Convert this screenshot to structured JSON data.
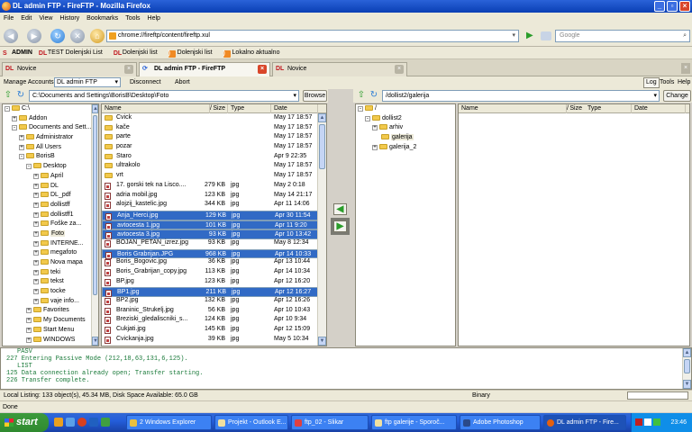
{
  "window": {
    "title": "DL admin FTP - FireFTP - Mozilla Firefox"
  },
  "menubar": [
    "File",
    "Edit",
    "View",
    "History",
    "Bookmarks",
    "Tools",
    "Help"
  ],
  "navbar": {
    "url": "chrome://fireftp/content/fireftp.xul",
    "search_placeholder": "Google"
  },
  "bookmarks": [
    "ADMIN",
    "TEST Dolenjski List",
    "Dolenjski list",
    "Dolenjski list",
    "Lokalno aktualno"
  ],
  "tabs": [
    "Novice",
    "DL admin FTP - FireFTP",
    "Novice"
  ],
  "ftpbar": {
    "manage_accounts": "Manage Accounts",
    "account": "DL admin FTP",
    "disconnect": "Disconnect",
    "abort": "Abort",
    "log": "Log",
    "tools": "Tools",
    "help": "Help"
  },
  "local": {
    "path": "C:\\Documents and Settings\\BorisB\\Desktop\\Foto",
    "browse": "Browse",
    "tree": [
      {
        "label": "C:\\",
        "level": 0,
        "exp": "-"
      },
      {
        "label": "Addon",
        "level": 1,
        "exp": "+"
      },
      {
        "label": "Documents and Sett...",
        "level": 1,
        "exp": "-"
      },
      {
        "label": "Administrator",
        "level": 2,
        "exp": "+"
      },
      {
        "label": "All Users",
        "level": 2,
        "exp": "+"
      },
      {
        "label": "BorisB",
        "level": 2,
        "exp": "-"
      },
      {
        "label": "Desktop",
        "level": 3,
        "exp": "-"
      },
      {
        "label": "April",
        "level": 4,
        "exp": "+"
      },
      {
        "label": "DL",
        "level": 4,
        "exp": "+"
      },
      {
        "label": "DL_pdf",
        "level": 4,
        "exp": "+"
      },
      {
        "label": "dollistff",
        "level": 4,
        "exp": "+"
      },
      {
        "label": "dollistff1",
        "level": 4,
        "exp": "+"
      },
      {
        "label": "Foške za...",
        "level": 4,
        "exp": "+"
      },
      {
        "label": "Foto",
        "level": 4,
        "exp": "+",
        "selected": true
      },
      {
        "label": "INTERNE...",
        "level": 4,
        "exp": "+"
      },
      {
        "label": "megafoto",
        "level": 4,
        "exp": "+"
      },
      {
        "label": "Nova mapa",
        "level": 4,
        "exp": "+"
      },
      {
        "label": "teki",
        "level": 4,
        "exp": "+"
      },
      {
        "label": "tekst",
        "level": 4,
        "exp": "+"
      },
      {
        "label": "tocke",
        "level": 4,
        "exp": "+"
      },
      {
        "label": "vaje info...",
        "level": 4,
        "exp": "+"
      },
      {
        "label": "Favorites",
        "level": 3,
        "exp": "+"
      },
      {
        "label": "My Documents",
        "level": 3,
        "exp": "+"
      },
      {
        "label": "Start Menu",
        "level": 3,
        "exp": "+"
      },
      {
        "label": "WINDOWS",
        "level": 3,
        "exp": "+"
      }
    ],
    "columns": {
      "name": "Name",
      "size": "Size",
      "type": "Type",
      "date": "Date"
    },
    "files": [
      {
        "name": "Cvick",
        "size": "",
        "type": "",
        "date": "May 17 18:57",
        "folder": true
      },
      {
        "name": "kače",
        "size": "",
        "type": "",
        "date": "May 17 18:57",
        "folder": true
      },
      {
        "name": "parte",
        "size": "",
        "type": "",
        "date": "May 17 18:57",
        "folder": true
      },
      {
        "name": "pozar",
        "size": "",
        "type": "",
        "date": "May 17 18:57",
        "folder": true
      },
      {
        "name": "Staro",
        "size": "",
        "type": "",
        "date": "Apr 9 22:35",
        "folder": true
      },
      {
        "name": "ultrakolo",
        "size": "",
        "type": "",
        "date": "May 17 18:57",
        "folder": true
      },
      {
        "name": "vrt",
        "size": "",
        "type": "",
        "date": "May 17 18:57",
        "folder": true
      },
      {
        "name": "17. gorski tek na Lisco....",
        "size": "279 KB",
        "type": "jpg",
        "date": "May 2 0:18"
      },
      {
        "name": "adria mobil.jpg",
        "size": "123 KB",
        "type": "jpg",
        "date": "May 14 21:17"
      },
      {
        "name": "alojzij_kastelic.jpg",
        "size": "344 KB",
        "type": "jpg",
        "date": "Apr 11 14:06"
      },
      {
        "name": "Anja_Herci.jpg",
        "size": "129 KB",
        "type": "jpg",
        "date": "Apr 30 11:54",
        "selected": true
      },
      {
        "name": "avtocesta 1.jpg",
        "size": "101 KB",
        "type": "jpg",
        "date": "Apr 11 9:20",
        "selected": true
      },
      {
        "name": "avtocesta 3.jpg",
        "size": "93 KB",
        "type": "jpg",
        "date": "Apr 10 13:42",
        "selected": true
      },
      {
        "name": "BOJAN_PETAN_izrez.jpg",
        "size": "93 KB",
        "type": "jpg",
        "date": "May 8 12:34"
      },
      {
        "name": "Boris Grabrijan.JPG",
        "size": "968 KB",
        "type": "jpg",
        "date": "Apr 14 10:33",
        "selected": true
      },
      {
        "name": "Boris_Bogovic.jpg",
        "size": "36 KB",
        "type": "jpg",
        "date": "Apr 13 10:44"
      },
      {
        "name": "Boris_Grabrijan_copy.jpg",
        "size": "113 KB",
        "type": "jpg",
        "date": "Apr 14 10:34"
      },
      {
        "name": "BP.jpg",
        "size": "123 KB",
        "type": "jpg",
        "date": "Apr 12 16:20"
      },
      {
        "name": "BP1.jpg",
        "size": "211 KB",
        "type": "jpg",
        "date": "Apr 12 16:27",
        "selected": true
      },
      {
        "name": "BP2.jpg",
        "size": "132 KB",
        "type": "jpg",
        "date": "Apr 12 16:26"
      },
      {
        "name": "Braninic_Strukelj.jpg",
        "size": "56 KB",
        "type": "jpg",
        "date": "Apr 10 10:43"
      },
      {
        "name": "Breziski_gledaliscniki_s...",
        "size": "124 KB",
        "type": "jpg",
        "date": "Apr 10 9:34"
      },
      {
        "name": "Cukjati.jpg",
        "size": "145 KB",
        "type": "jpg",
        "date": "Apr 12 15:09"
      },
      {
        "name": "Cvickanja.jpg",
        "size": "39 KB",
        "type": "jpg",
        "date": "May 5 10:34"
      }
    ],
    "status": "Local Listing: 133 object(s), 45.34 MB, Disk Space Available: 65.0 GB"
  },
  "remote": {
    "path": "/dollist2/galerija",
    "change": "Change",
    "tree": [
      {
        "label": "/",
        "level": 0,
        "exp": "-"
      },
      {
        "label": "dollist2",
        "level": 1,
        "exp": "-"
      },
      {
        "label": "arhiv",
        "level": 2,
        "exp": "+"
      },
      {
        "label": "galerija",
        "level": 2,
        "exp": "",
        "selected": true
      },
      {
        "label": "galerija_2",
        "level": 2,
        "exp": "+"
      }
    ],
    "columns": {
      "name": "Name",
      "size": "Size",
      "type": "Type",
      "date": "Date"
    }
  },
  "log": [
    "PASV",
    "227 Entering Passive Mode (212,18,63,131,6,125).",
    "LIST",
    "125 Data connection already open; Transfer starting.",
    "226 Transfer complete."
  ],
  "status": {
    "mode": "Binary"
  },
  "statusbar": {
    "text": "Done"
  },
  "taskbar": {
    "start": "start",
    "buttons": [
      "2 Windows Explorer",
      "Projekt - Outlook E...",
      "ftp_02 - Slikar",
      "ftp galerije - Sporoč...",
      "Adobe Photoshop",
      "DL admin FTP - Fire..."
    ],
    "clock": "23:46"
  }
}
